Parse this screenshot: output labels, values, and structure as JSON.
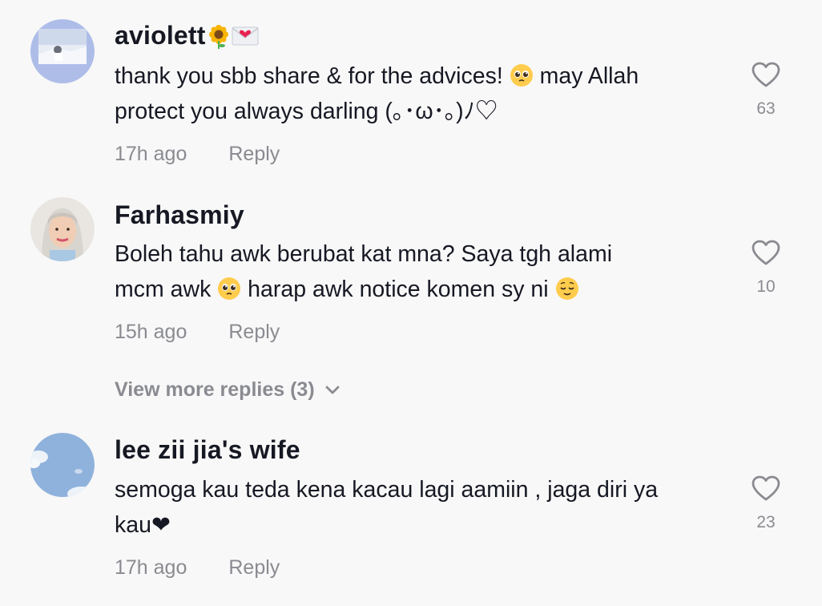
{
  "comments": [
    {
      "username": "aviolett",
      "username_emojis": [
        "sunflower-emoji",
        "love-letter-emoji"
      ],
      "text_line1_a": "thank you sbb share & for the advices! ",
      "text_line1_b": " may Allah",
      "text_line2": "protect you always darling (｡･ω･｡)ﾉ♡",
      "time": "17h ago",
      "reply_label": "Reply",
      "likes": "63"
    },
    {
      "username": "Farhasmiy",
      "text_line1": "Boleh tahu awk berubat kat mna? Saya tgh alami",
      "text_line2_a": "mcm awk ",
      "text_line2_b": " harap awk notice komen sy ni ",
      "time": "15h ago",
      "reply_label": "Reply",
      "likes": "10"
    },
    {
      "username": "lee zii jia's wife",
      "text_line1": "semoga kau teda kena kacau lagi aamiin , jaga diri ya",
      "text_line2": "kau❤",
      "time": "17h ago",
      "reply_label": "Reply",
      "likes": "23"
    }
  ],
  "view_more_replies": "View more replies (3)",
  "colors": {
    "background": "#f8f8f8",
    "primary_text": "#161823",
    "secondary_text": "#8a8b91"
  }
}
